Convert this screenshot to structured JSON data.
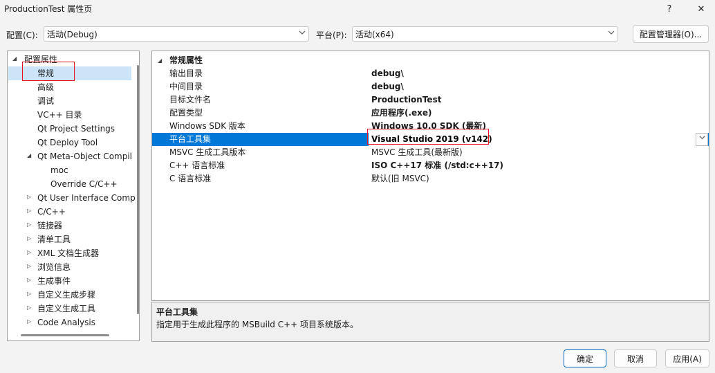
{
  "window": {
    "title": "ProductionTest 属性页",
    "help_label": "?",
    "close_label": "✕"
  },
  "toolbar": {
    "config_label": "配置(C):",
    "config_value": "活动(Debug)",
    "platform_label": "平台(P):",
    "platform_value": "活动(x64)",
    "config_manager_label": "配置管理器(O)..."
  },
  "tree": {
    "root": {
      "label": "配置属性",
      "expander": "◢"
    },
    "items": [
      {
        "label": "常规",
        "selected": true
      },
      {
        "label": "高级"
      },
      {
        "label": "调试"
      },
      {
        "label": "VC++ 目录"
      },
      {
        "label": "Qt Project Settings"
      },
      {
        "label": "Qt Deploy Tool"
      },
      {
        "label": "Qt Meta-Object Compil",
        "expander": "◢"
      },
      {
        "label": "moc",
        "child": true
      },
      {
        "label": "Override C/C++",
        "child": true
      },
      {
        "label": "Qt User Interface Comp",
        "expander": "▷"
      },
      {
        "label": "C/C++",
        "expander": "▷"
      },
      {
        "label": "链接器",
        "expander": "▷"
      },
      {
        "label": "清单工具",
        "expander": "▷"
      },
      {
        "label": "XML 文档生成器",
        "expander": "▷"
      },
      {
        "label": "浏览信息",
        "expander": "▷"
      },
      {
        "label": "生成事件",
        "expander": "▷"
      },
      {
        "label": "自定义生成步骤",
        "expander": "▷"
      },
      {
        "label": "自定义生成工具",
        "expander": "▷"
      },
      {
        "label": "Code Analysis",
        "expander": "▷"
      }
    ]
  },
  "grid": {
    "section": {
      "label": "常规属性",
      "expander": "◢"
    },
    "rows": [
      {
        "name": "输出目录",
        "value": "debug\\",
        "bold": true
      },
      {
        "name": "中间目录",
        "value": "debug\\",
        "bold": true
      },
      {
        "name": "目标文件名",
        "value": "ProductionTest",
        "bold": true
      },
      {
        "name": "配置类型",
        "value": "应用程序(.exe)",
        "bold": true
      },
      {
        "name": "Windows SDK 版本",
        "value": "Windows 10.0 SDK (最新)",
        "bold": true
      },
      {
        "name": "平台工具集",
        "value": "Visual Studio 2019 (v142)",
        "bold": true,
        "selected": true
      },
      {
        "name": "MSVC 生成工具版本",
        "value": "MSVC 生成工具(最新版)",
        "bold": false
      },
      {
        "name": "C++ 语言标准",
        "value": "ISO C++17 标准 (/std:c++17)",
        "bold": true
      },
      {
        "name": "C 语言标准",
        "value": "默认(旧 MSVC)",
        "bold": false
      }
    ]
  },
  "description": {
    "title": "平台工具集",
    "text": "指定用于生成此程序的 MSBuild C++ 项目系统版本。"
  },
  "buttons": {
    "ok": "确定",
    "cancel": "取消",
    "apply": "应用(A)"
  },
  "colors": {
    "selection": "#0078d7",
    "highlight_box": "#e81123",
    "window_bg": "#f3f3f3"
  }
}
